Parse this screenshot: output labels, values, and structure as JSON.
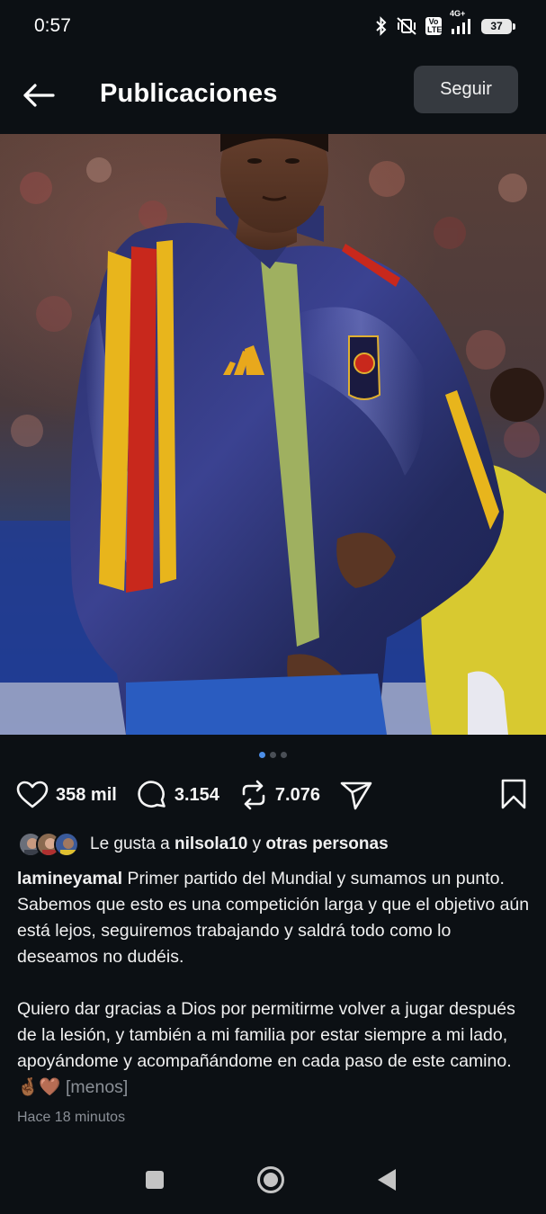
{
  "status_bar": {
    "time": "0:57",
    "network": "4G+",
    "volte": "Vo LTE",
    "battery": "37",
    "icons": [
      "bluetooth-icon",
      "vibrate-off-icon",
      "volte-icon",
      "signal-icon",
      "battery-icon"
    ]
  },
  "header": {
    "title": "Publicaciones",
    "follow_label": "Seguir",
    "back_icon": "arrow-left-icon"
  },
  "carousel": {
    "total": 3,
    "current": 1
  },
  "actions": {
    "likes": "358 mil",
    "comments": "3.154",
    "reposts": "7.076",
    "icons": [
      "heart-icon",
      "comment-icon",
      "repost-icon",
      "send-icon",
      "bookmark-icon"
    ]
  },
  "liked_by": {
    "prefix": "Le gusta a",
    "user": "nilsola10",
    "connector": "y",
    "others": "otras personas"
  },
  "caption": {
    "username": "lamineyamal",
    "paragraph1": "Primer partido del Mundial y sumamos un punto. Sabemos que esto es una competición larga y que el objetivo aún está lejos, seguiremos trabajando y saldrá todo como lo deseamos no dudéis.",
    "paragraph2": "Quiero dar gracias a Dios por permitirme volver a jugar después de la lesión, y también a mi familia por estar siempre a mi lado, apoyándome y acompañándome en cada paso de este camino.",
    "emojis": "🤞🏾🤎",
    "less_label": "[menos]"
  },
  "timestamp": "Hace 18 minutos",
  "colors": {
    "background": "#0c1014",
    "follow_button": "#363a40",
    "active_dot": "#4c8ee8",
    "muted_text": "#8a8f96"
  }
}
